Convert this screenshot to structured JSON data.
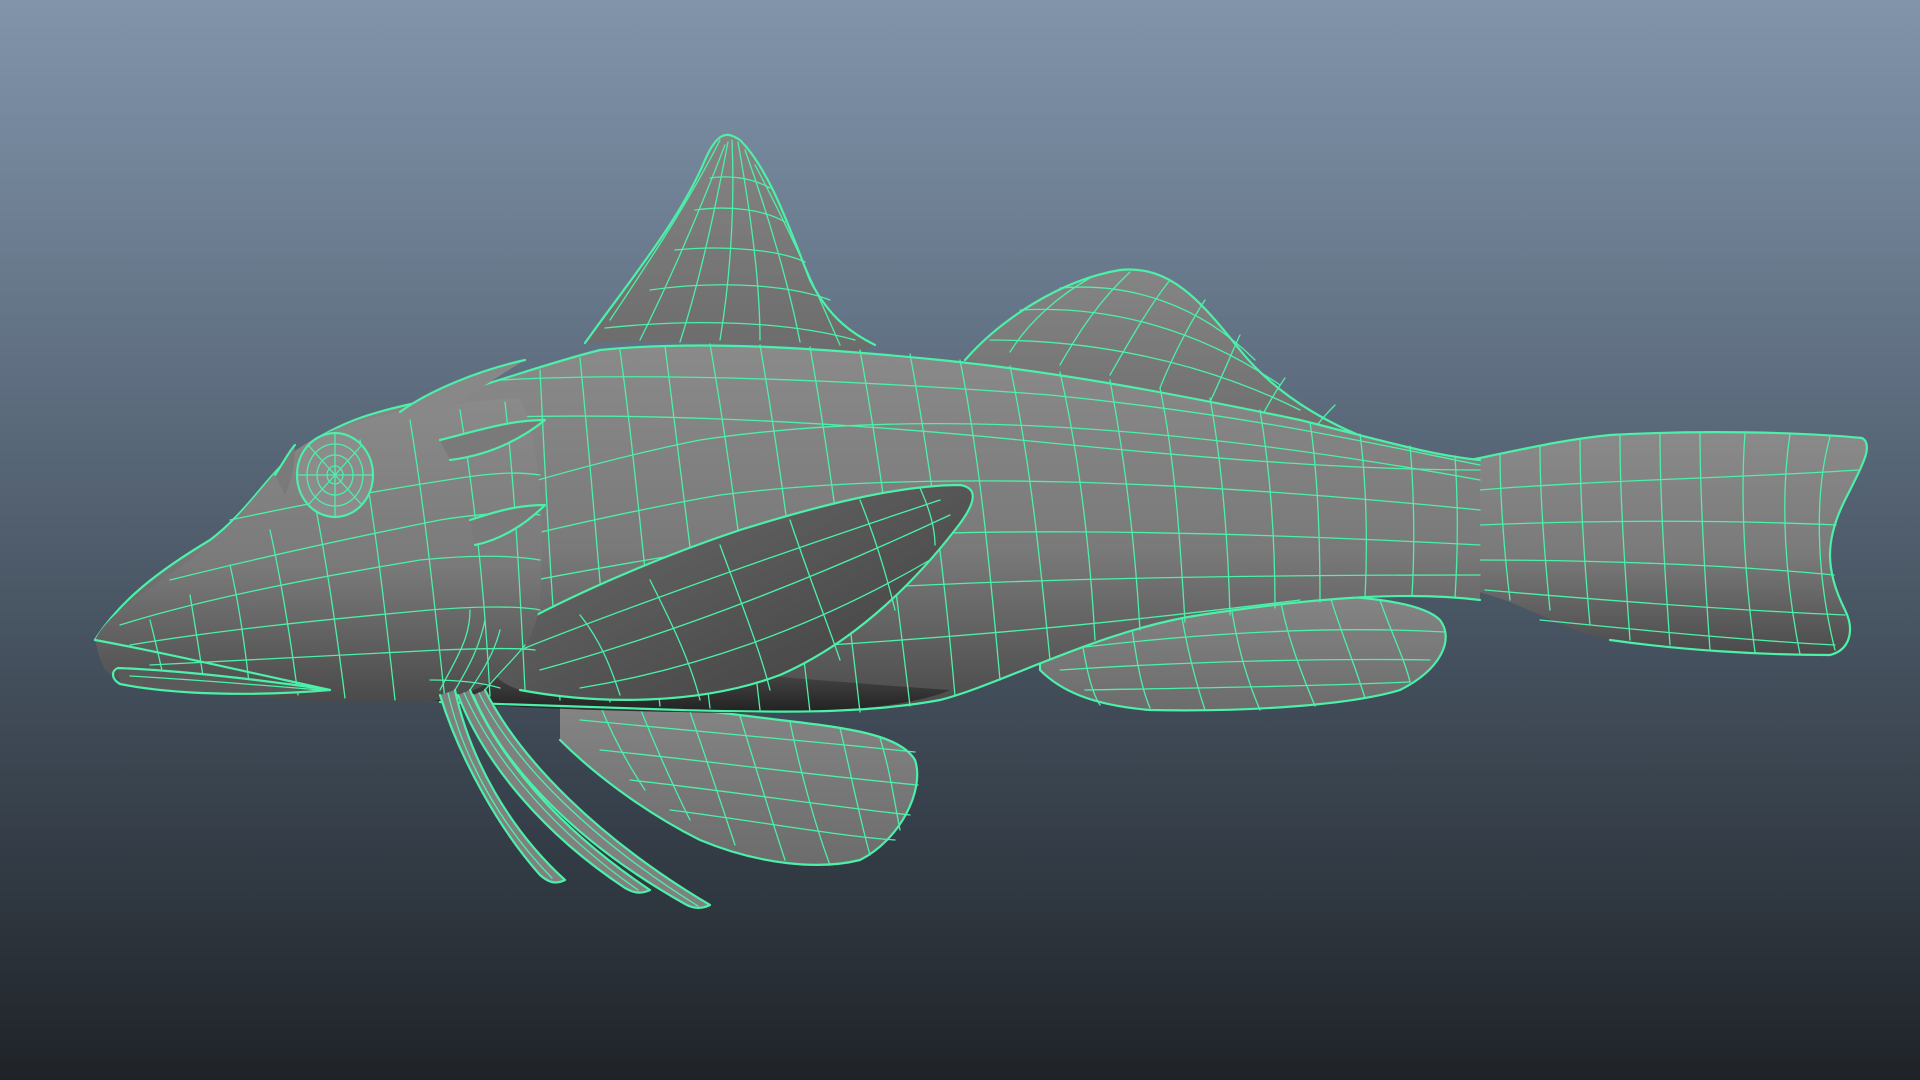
{
  "viewport": {
    "background_top": "#8194aa",
    "background_bottom": "#1f2328"
  },
  "model": {
    "shading": "wireframe-on-shaded",
    "surface_color": "#7b7b7b",
    "surface_shadow": "#3c3c3c",
    "wireframe_color": "#4cf0a8"
  }
}
